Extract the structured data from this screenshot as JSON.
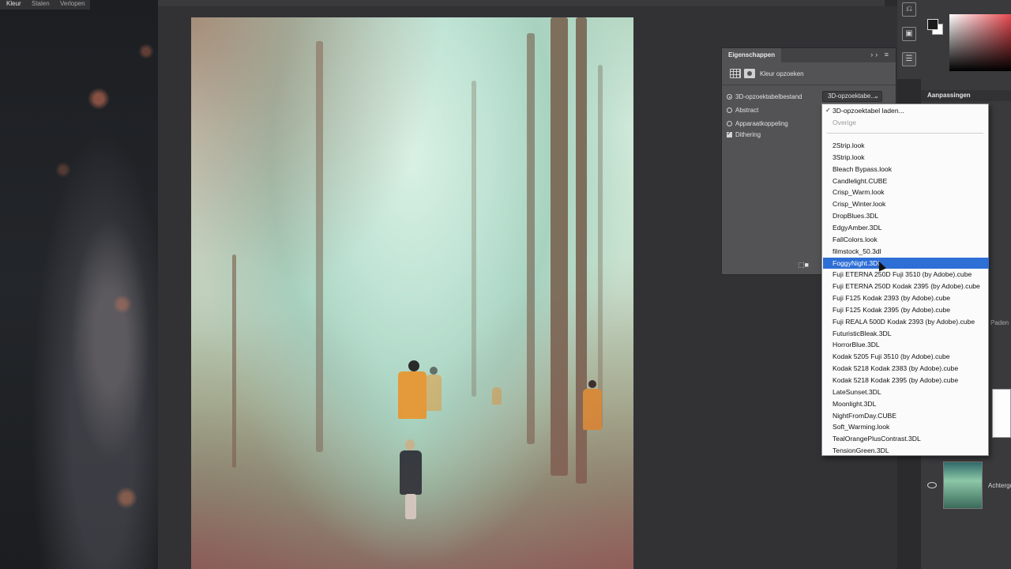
{
  "right_panel": {
    "tabs": [
      "Kleur",
      "Stalen",
      "Verlopen"
    ],
    "adjustments_label": "Aanpassingen",
    "paths_label": "Paden",
    "layer_name": "Achtergr"
  },
  "properties": {
    "tab_label": "Eigenschappen",
    "title": "Kleur opzoeken",
    "options": [
      {
        "label": "3D-opzoektabelbestand",
        "type": "radio",
        "selected": true
      },
      {
        "label": "Abstract",
        "type": "radio",
        "selected": false
      },
      {
        "label": "Apparaatkoppeling",
        "type": "radio",
        "selected": false
      },
      {
        "label": "Dithering",
        "type": "checkbox",
        "checked": true
      }
    ],
    "select_value": "3D-opzoektabe..."
  },
  "dropdown": {
    "load_item": "3D-opzoektabel laden...",
    "other_label": "Overige",
    "items": [
      "2Strip.look",
      "3Strip.look",
      "Bleach Bypass.look",
      "Candlelight.CUBE",
      "Crisp_Warm.look",
      "Crisp_Winter.look",
      "DropBlues.3DL",
      "EdgyAmber.3DL",
      "FallColors.look",
      "filmstock_50.3dl",
      "FoggyNight.3DL",
      "Fuji ETERNA 250D Fuji 3510 (by Adobe).cube",
      "Fuji ETERNA 250D Kodak 2395 (by Adobe).cube",
      "Fuji F125 Kodak 2393 (by Adobe).cube",
      "Fuji F125 Kodak 2395 (by Adobe).cube",
      "Fuji REALA 500D Kodak 2393 (by Adobe).cube",
      "FuturisticBleak.3DL",
      "HorrorBlue.3DL",
      "Kodak 5205 Fuji 3510 (by Adobe).cube",
      "Kodak 5218 Kodak 2383 (by Adobe).cube",
      "Kodak 5218 Kodak 2395 (by Adobe).cube",
      "LateSunset.3DL",
      "Moonlight.3DL",
      "NightFromDay.CUBE",
      "Soft_Warming.look",
      "TealOrangePlusContrast.3DL",
      "TensionGreen.3DL"
    ],
    "selected_item": "FoggyNight.3DL",
    "colors": {
      "highlight": "#2e6fd6",
      "disabled": "#9a9a9a"
    }
  }
}
